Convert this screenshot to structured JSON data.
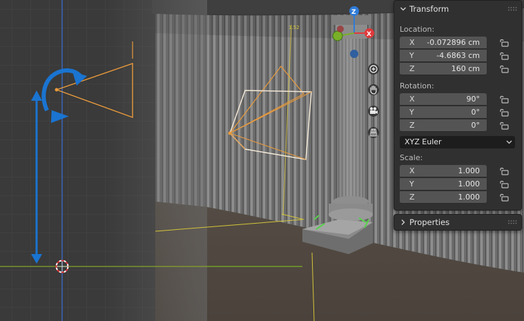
{
  "transform": {
    "title": "Transform",
    "location": {
      "label": "Location:",
      "fields": [
        {
          "axis": "X",
          "value": "-0.072896 cm"
        },
        {
          "axis": "Y",
          "value": "-4.6863 cm"
        },
        {
          "axis": "Z",
          "value": "160 cm"
        }
      ]
    },
    "rotation": {
      "label": "Rotation:",
      "fields": [
        {
          "axis": "X",
          "value": "90°"
        },
        {
          "axis": "Y",
          "value": "0°"
        },
        {
          "axis": "Z",
          "value": "0°"
        }
      ],
      "mode": "XYZ Euler"
    },
    "scale": {
      "label": "Scale:",
      "fields": [
        {
          "axis": "X",
          "value": "1.000"
        },
        {
          "axis": "Y",
          "value": "1.000"
        },
        {
          "axis": "Z",
          "value": "1.000"
        }
      ]
    }
  },
  "properties": {
    "title": "Properties"
  },
  "gizmo": {
    "x_label": "X",
    "z_label": "Z"
  },
  "icons": {
    "zoom": "zoom-plus-icon",
    "pan": "hand-pan-icon",
    "camera": "camera-icon",
    "grid": "ortho-grid-icon",
    "lock": "lock-open-icon"
  },
  "colors": {
    "panel_bg": "#303030",
    "field_bg": "#545454",
    "dropdown_bg": "#1d1d1d",
    "camera_orange": "#e89a3c",
    "annotation_blue": "#1a74d1",
    "axis_green": "#79b027",
    "axis_red": "#e0393c",
    "axis_blue_line": "#3b6fd6",
    "gizmo_z": "#2f7bd8"
  }
}
